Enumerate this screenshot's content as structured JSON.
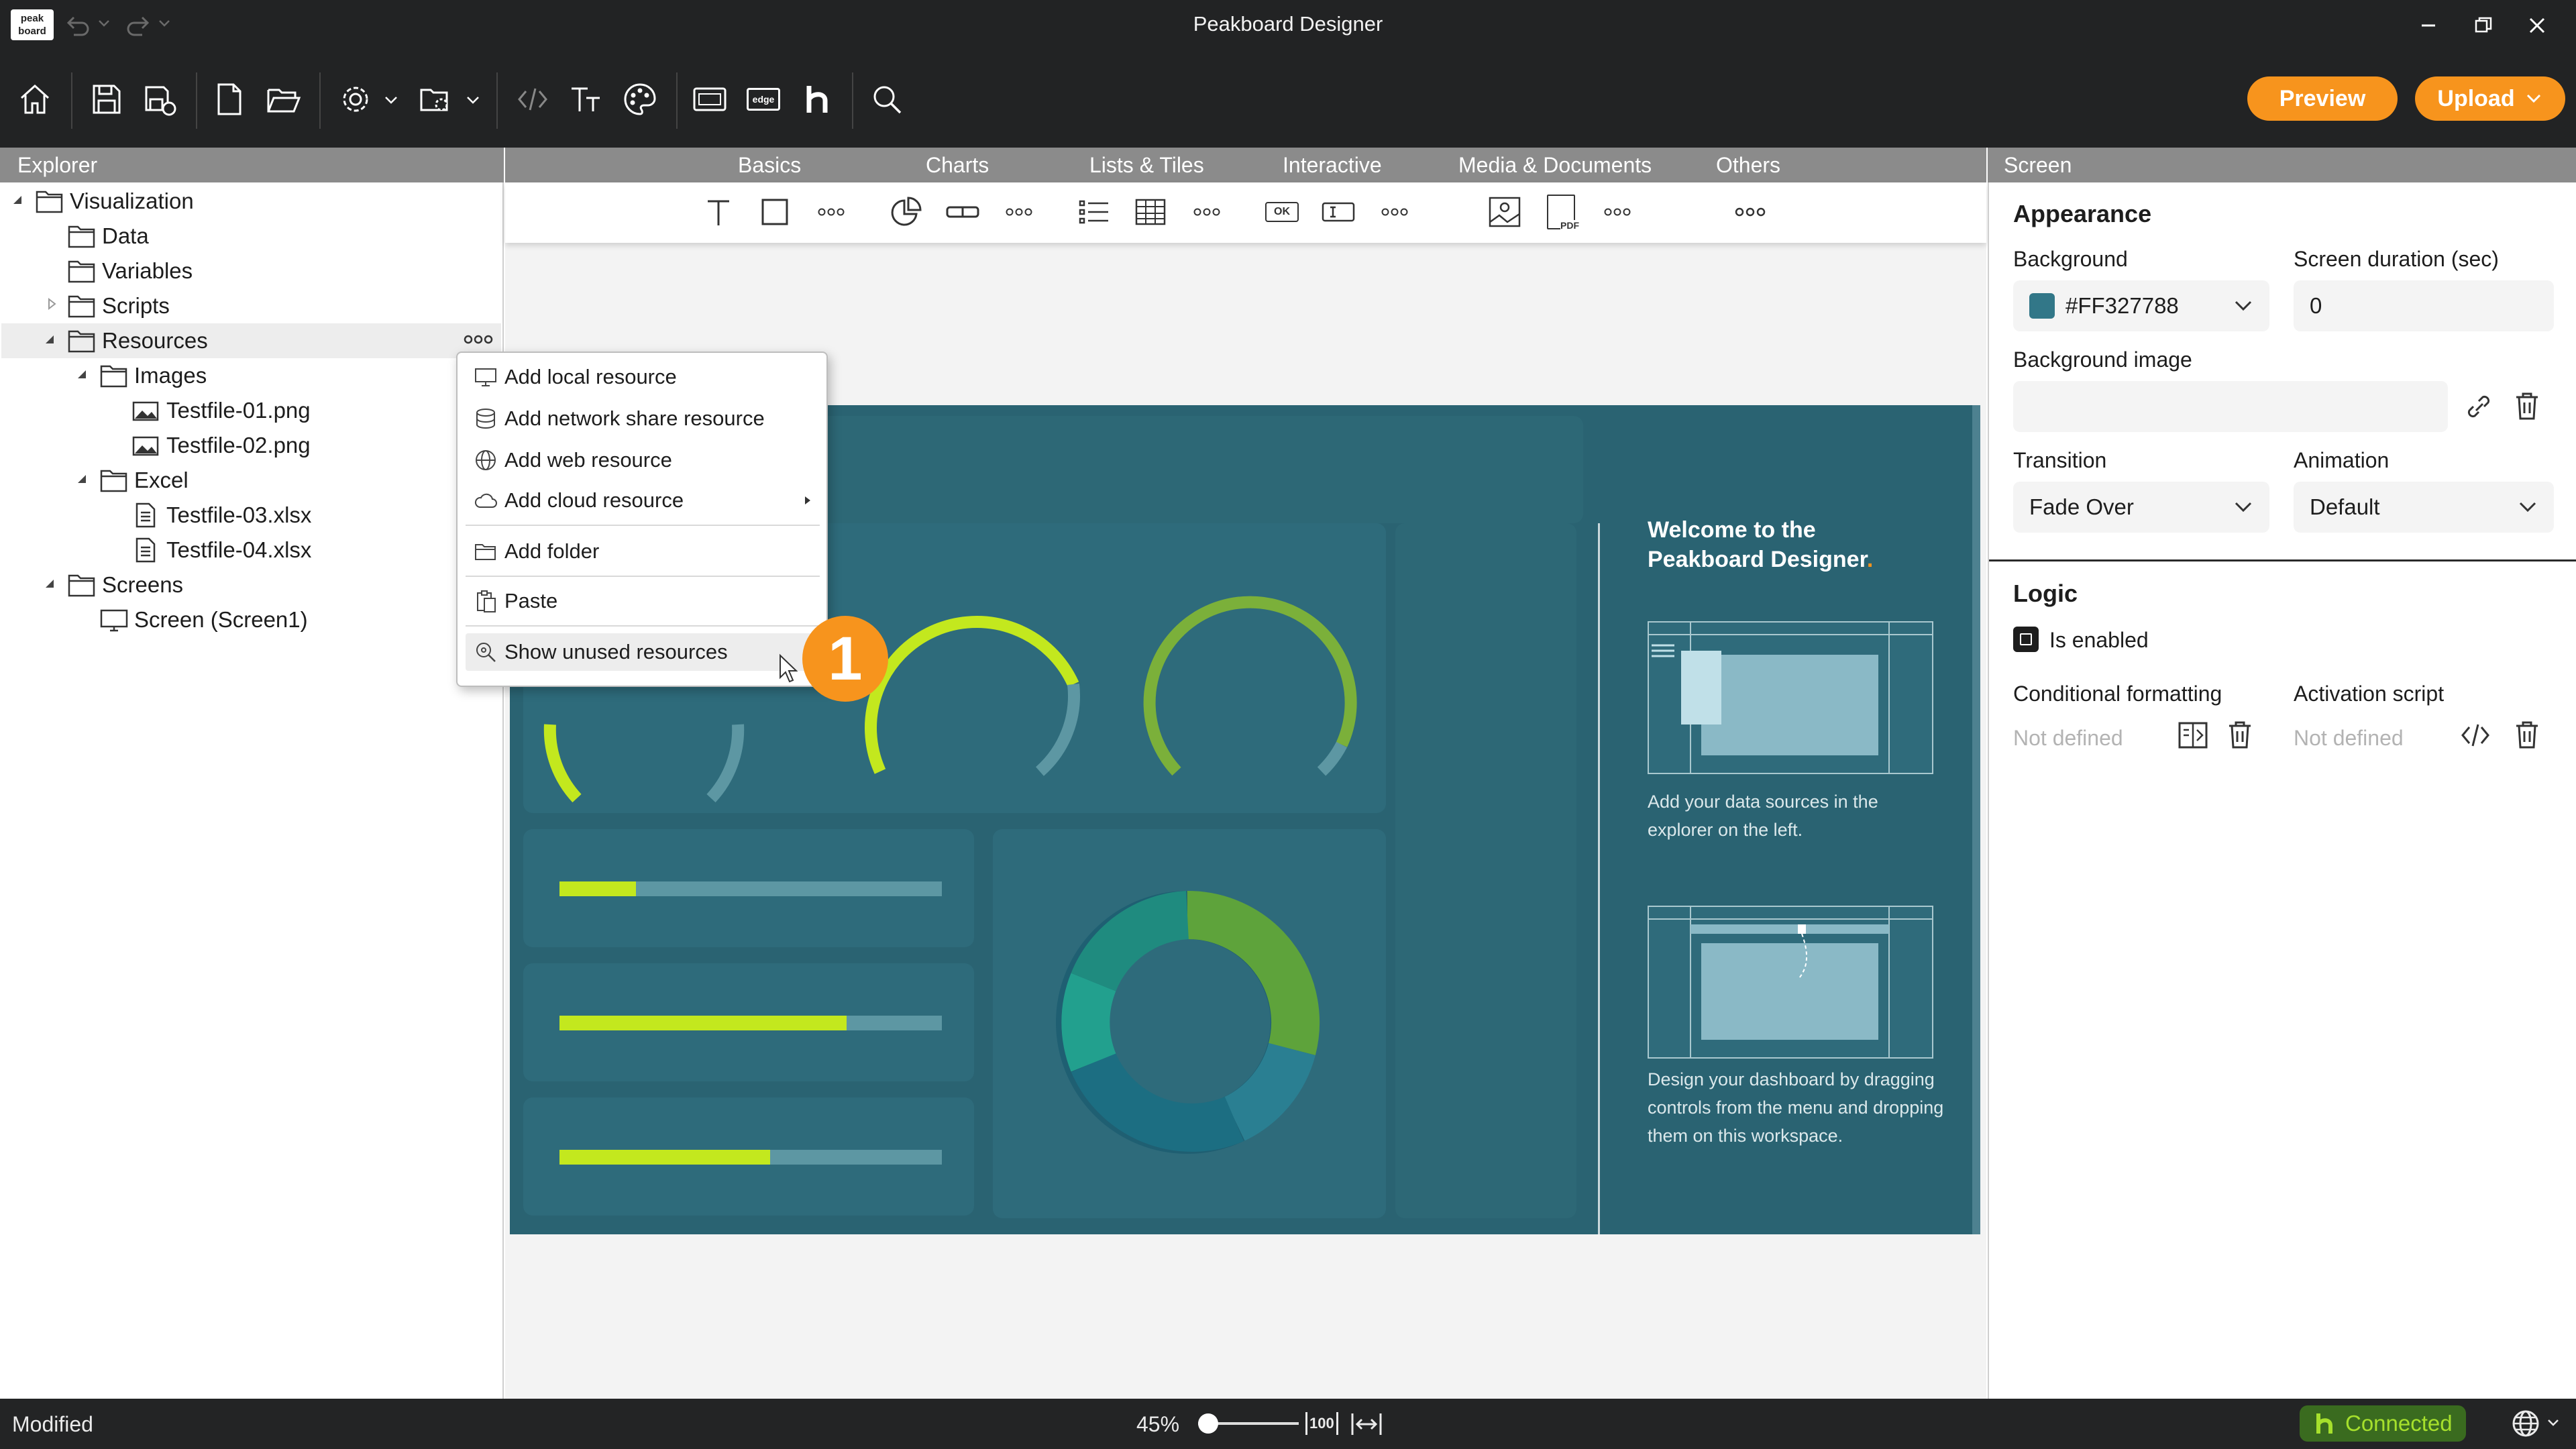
{
  "window": {
    "title": "Peakboard Designer",
    "logo_lines": [
      "peak",
      "board"
    ]
  },
  "toolbar": {
    "preview_label": "Preview",
    "upload_label": "Upload",
    "logo_text": "edge"
  },
  "explorer": {
    "header": "Explorer",
    "items": [
      {
        "label": "Visualization"
      },
      {
        "label": "Data"
      },
      {
        "label": "Variables"
      },
      {
        "label": "Scripts"
      },
      {
        "label": "Resources"
      },
      {
        "label": "Images"
      },
      {
        "label": "Testfile-01.png"
      },
      {
        "label": "Testfile-02.png"
      },
      {
        "label": "Excel"
      },
      {
        "label": "Testfile-03.xlsx"
      },
      {
        "label": "Testfile-04.xlsx"
      },
      {
        "label": "Screens"
      },
      {
        "label": "Screen (Screen1)"
      }
    ]
  },
  "context_menu": {
    "items": [
      {
        "label": "Add local resource"
      },
      {
        "label": "Add network share resource"
      },
      {
        "label": "Add web resource"
      },
      {
        "label": "Add cloud resource"
      },
      {
        "label": "Add folder"
      },
      {
        "label": "Paste"
      },
      {
        "label": "Show unused resources"
      }
    ],
    "step_badge": "1"
  },
  "palette": {
    "tabs": [
      {
        "label": "Basics"
      },
      {
        "label": "Charts"
      },
      {
        "label": "Lists & Tiles"
      },
      {
        "label": "Interactive"
      },
      {
        "label": "Media & Documents"
      },
      {
        "label": "Others"
      }
    ],
    "interactive_button_text": "OK",
    "pdf_text": "PDF"
  },
  "dashboard": {
    "welcome_title": "Welcome to the",
    "welcome_title2": "Peakboard Designer",
    "welcome_dot": ".",
    "tip1": [
      "Add your data sources in the",
      "explorer on the left."
    ],
    "tip2": [
      "Design your dashboard by dragging",
      "controls from the menu and dropping",
      "them on this workspace."
    ],
    "progress_bars": [
      0.2,
      0.75,
      0.55
    ],
    "accent_color": "#c3e81e"
  },
  "properties": {
    "header": "Screen",
    "appearance_title": "Appearance",
    "background_label": "Background",
    "background_value": "#FF327788",
    "background_color": "#327788",
    "duration_label": "Screen duration (sec)",
    "duration_value": "0",
    "background_image_label": "Background image",
    "transition_label": "Transition",
    "transition_value": "Fade Over",
    "animation_label": "Animation",
    "animation_value": "Default",
    "logic_title": "Logic",
    "enabled_label": "Is enabled",
    "cond_format_label": "Conditional formatting",
    "cond_format_value": "Not defined",
    "activation_label": "Activation script",
    "activation_value": "Not defined"
  },
  "status": {
    "left": "Modified",
    "zoom": "45%",
    "fit_label": "100",
    "connected": "Connected"
  }
}
